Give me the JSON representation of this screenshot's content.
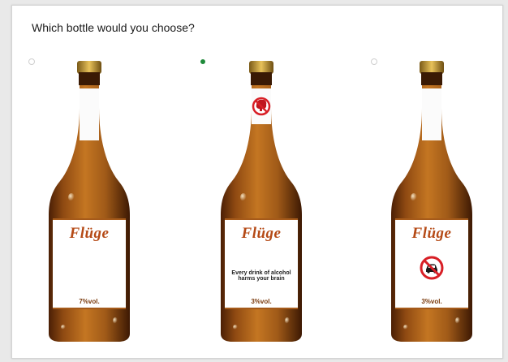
{
  "survey": {
    "question": "Which bottle would you choose?"
  },
  "options": [
    {
      "brand": "Flüge",
      "abv": "7%vol.",
      "warning_text": "",
      "icon": "none",
      "selected": false
    },
    {
      "brand": "Flüge",
      "abv": "3%vol.",
      "warning_text": "Every drink of alcohol harms your brain",
      "icon": "no-brain-icon",
      "selected": true
    },
    {
      "brand": "Flüge",
      "abv": "3%vol.",
      "warning_text": "",
      "icon": "no-car-icon",
      "selected": false
    }
  ],
  "colors": {
    "beer": "#8a4a16",
    "brand_text": "#b54a16",
    "radio_selected": "#1f8a3a",
    "prohibit_red": "#d81f26"
  }
}
